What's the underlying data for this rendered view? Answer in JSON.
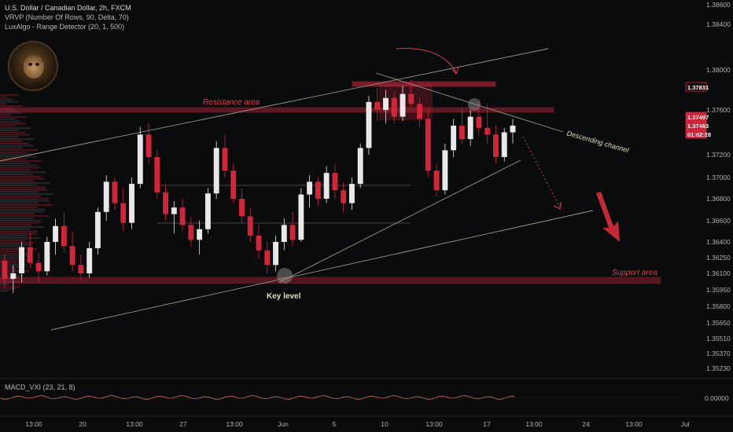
{
  "header": {
    "symbol_line": "U.S. Dollar / Canadian Dollar, 2h, FXCM",
    "indicator_1": "VRVP (Number Of Rows, 90, Delta, 70)",
    "indicator_2": "LuxAlgo - Range Detector (20, 1, 500)"
  },
  "annotations": {
    "resistance": "Resistance area",
    "support": "Support area",
    "key_level": "Key level",
    "channel": "Descending channel"
  },
  "macd": {
    "label": "MACD_VXI (23, 21, 8)",
    "zero_label": "0.00000"
  },
  "price_tags": [
    {
      "label": "1.37831",
      "value": 1.37831,
      "style": "outline"
    },
    {
      "label": "1.37497",
      "value": 1.37497,
      "style": "filled"
    },
    {
      "label": "1.37463",
      "value": 1.37463,
      "style": "filled"
    },
    {
      "label": "01:02:28",
      "value": 1.3736,
      "style": "filled"
    }
  ],
  "colors": {
    "background": "#0a0b0d",
    "bullish": "#e8e8e8",
    "bearish": "#d1253a",
    "zone": "#c2283b",
    "trendline": "#9a9a8a",
    "accent_red": "#e03c4a"
  },
  "chart_data": {
    "type": "candlestick",
    "title": "U.S. Dollar / Canadian Dollar, 2h, FXCM",
    "y_ticks": [
      "1.38600",
      "1.38400",
      "1.38000",
      "1.37600",
      "1.37200",
      "1.37000",
      "1.36800",
      "1.36600",
      "1.36400",
      "1.36250",
      "1.36100",
      "1.35950",
      "1.35800",
      "1.35650",
      "1.35510",
      "1.35370",
      "1.35230"
    ],
    "x_ticks": [
      "13:00",
      "20",
      "13:00",
      "27",
      "13:00",
      "Jun",
      "5",
      "10",
      "13:00",
      "17",
      "13:00",
      "24",
      "13:00",
      "Jul"
    ],
    "ylim": [
      1.3523,
      1.386
    ],
    "ohlc": [
      [
        1.3622,
        1.3628,
        1.3596,
        1.3605
      ],
      [
        1.3605,
        1.3618,
        1.3592,
        1.361
      ],
      [
        1.361,
        1.364,
        1.3602,
        1.3635
      ],
      [
        1.3635,
        1.3648,
        1.3615,
        1.362
      ],
      [
        1.362,
        1.363,
        1.3601,
        1.3612
      ],
      [
        1.3612,
        1.3645,
        1.3608,
        1.364
      ],
      [
        1.364,
        1.3662,
        1.3628,
        1.3655
      ],
      [
        1.3655,
        1.3668,
        1.363,
        1.3636
      ],
      [
        1.3636,
        1.365,
        1.3612,
        1.3618
      ],
      [
        1.3618,
        1.3628,
        1.3603,
        1.361
      ],
      [
        1.361,
        1.364,
        1.3606,
        1.3634
      ],
      [
        1.3634,
        1.3672,
        1.3628,
        1.3668
      ],
      [
        1.3668,
        1.3702,
        1.366,
        1.3696
      ],
      [
        1.3696,
        1.37,
        1.367,
        1.3676
      ],
      [
        1.3676,
        1.369,
        1.365,
        1.3658
      ],
      [
        1.3658,
        1.37,
        1.3652,
        1.3694
      ],
      [
        1.3694,
        1.3745,
        1.369,
        1.3738
      ],
      [
        1.3738,
        1.3748,
        1.3712,
        1.3718
      ],
      [
        1.3718,
        1.3725,
        1.368,
        1.3686
      ],
      [
        1.3686,
        1.3694,
        1.366,
        1.3666
      ],
      [
        1.3666,
        1.3678,
        1.3648,
        1.3672
      ],
      [
        1.3672,
        1.368,
        1.365,
        1.3656
      ],
      [
        1.3656,
        1.3664,
        1.3636,
        1.3642
      ],
      [
        1.3642,
        1.366,
        1.3628,
        1.3652
      ],
      [
        1.3652,
        1.369,
        1.3648,
        1.3685
      ],
      [
        1.3685,
        1.3732,
        1.368,
        1.3726
      ],
      [
        1.3726,
        1.3738,
        1.37,
        1.3706
      ],
      [
        1.3706,
        1.3712,
        1.3676,
        1.368
      ],
      [
        1.368,
        1.369,
        1.3658,
        1.3664
      ],
      [
        1.3664,
        1.3672,
        1.364,
        1.3646
      ],
      [
        1.3646,
        1.3656,
        1.3624,
        1.3632
      ],
      [
        1.3632,
        1.364,
        1.361,
        1.3618
      ],
      [
        1.3618,
        1.3646,
        1.3612,
        1.364
      ],
      [
        1.364,
        1.3662,
        1.3632,
        1.3656
      ],
      [
        1.3656,
        1.3668,
        1.3636,
        1.3642
      ],
      [
        1.3642,
        1.369,
        1.364,
        1.3684
      ],
      [
        1.3684,
        1.3702,
        1.3672,
        1.3696
      ],
      [
        1.3696,
        1.37,
        1.3674,
        1.368
      ],
      [
        1.368,
        1.371,
        1.3676,
        1.3704
      ],
      [
        1.3704,
        1.3712,
        1.368,
        1.3688
      ],
      [
        1.3688,
        1.3696,
        1.3668,
        1.3676
      ],
      [
        1.3676,
        1.37,
        1.367,
        1.3694
      ],
      [
        1.3694,
        1.373,
        1.369,
        1.3726
      ],
      [
        1.3726,
        1.3774,
        1.372,
        1.3768
      ],
      [
        1.3768,
        1.3782,
        1.375,
        1.376
      ],
      [
        1.376,
        1.378,
        1.3748,
        1.3772
      ],
      [
        1.3772,
        1.3778,
        1.3748,
        1.3754
      ],
      [
        1.3754,
        1.3784,
        1.375,
        1.3776
      ],
      [
        1.3776,
        1.379,
        1.3762,
        1.3766
      ],
      [
        1.3766,
        1.3772,
        1.3745,
        1.3752
      ],
      [
        1.3752,
        1.376,
        1.37,
        1.3706
      ],
      [
        1.3706,
        1.3712,
        1.3682,
        1.3688
      ],
      [
        1.3688,
        1.373,
        1.3684,
        1.3724
      ],
      [
        1.3724,
        1.3752,
        1.3718,
        1.3746
      ],
      [
        1.3746,
        1.3762,
        1.373,
        1.3734
      ],
      [
        1.3734,
        1.376,
        1.3728,
        1.3754
      ],
      [
        1.3754,
        1.377,
        1.3738,
        1.3744
      ],
      [
        1.3744,
        1.3766,
        1.373,
        1.3738
      ],
      [
        1.3738,
        1.3746,
        1.3712,
        1.3718
      ],
      [
        1.3718,
        1.3744,
        1.3714,
        1.374
      ],
      [
        1.374,
        1.3752,
        1.373,
        1.3746
      ]
    ],
    "zones": [
      {
        "name": "Resistance area",
        "from": 1.3757,
        "to": 1.3764
      },
      {
        "name": "Support area",
        "from": 1.36045,
        "to": 1.36095
      }
    ],
    "macd_value": 0.0
  }
}
